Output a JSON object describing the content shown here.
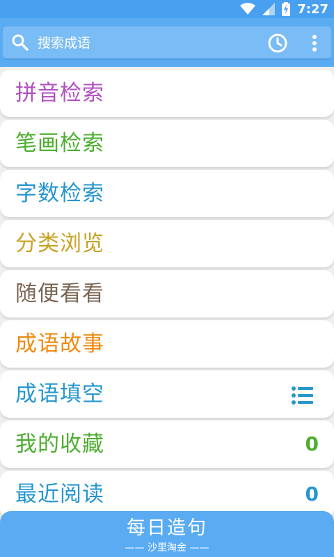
{
  "status_bar": {
    "time": "7:27",
    "icons": [
      "wifi-icon",
      "signal-icon",
      "battery-charging-icon"
    ]
  },
  "search": {
    "placeholder": "搜索成语",
    "icons": [
      "search-icon",
      "history-icon",
      "more-vert-icon"
    ]
  },
  "menu": {
    "items": [
      {
        "label": "拼音检索",
        "color": "#b152c0"
      },
      {
        "label": "笔画检索",
        "color": "#4cae2f"
      },
      {
        "label": "字数检索",
        "color": "#2596d0"
      },
      {
        "label": "分类浏览",
        "color": "#c9a325"
      },
      {
        "label": "随便看看",
        "color": "#7b6654"
      },
      {
        "label": "成语故事",
        "color": "#f08a10"
      },
      {
        "label": "成语填空",
        "color": "#2596d0",
        "icon": "list-icon"
      },
      {
        "label": "我的收藏",
        "color": "#4cae2f",
        "count": "0"
      },
      {
        "label": "最近阅读",
        "color": "#2596d0",
        "count": "0"
      }
    ]
  },
  "bottom": {
    "title": "每日造句",
    "subtitle": "—— 沙里淘金 ——"
  },
  "colors": {
    "status_bar": "#4aa0f0",
    "toolbar": "#5aabf2",
    "background": "#efefef"
  }
}
